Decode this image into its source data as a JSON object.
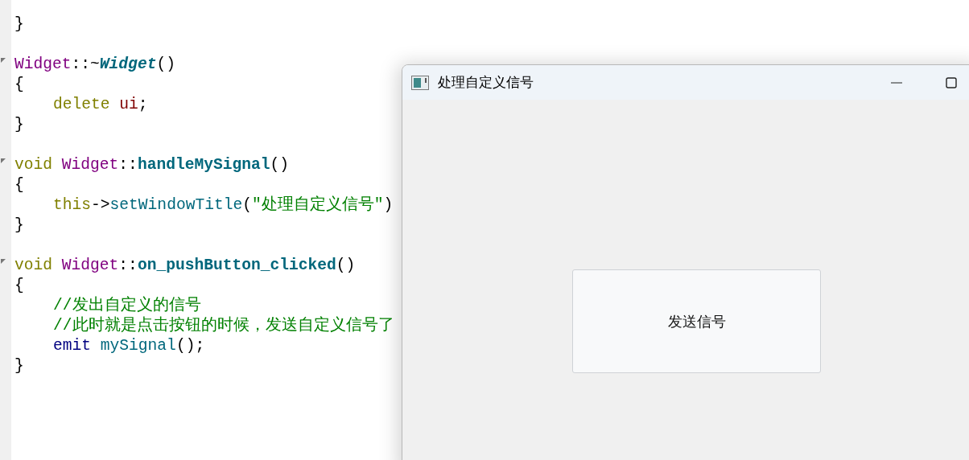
{
  "editor": {
    "blocks": [
      [
        {
          "fold": false,
          "indent": false,
          "tokens": [
            {
              "text": "}",
              "kind": "plain"
            }
          ]
        }
      ],
      [
        {
          "fold": true,
          "indent": false,
          "tokens": [
            {
              "text": "Widget",
              "kind": "type"
            },
            {
              "text": "::~",
              "kind": "plain"
            },
            {
              "text": "Widget",
              "kind": "dtor"
            },
            {
              "text": "()",
              "kind": "plain"
            }
          ]
        },
        {
          "fold": false,
          "indent": false,
          "tokens": [
            {
              "text": "{",
              "kind": "plain"
            }
          ]
        },
        {
          "fold": false,
          "indent": true,
          "tokens": [
            {
              "text": "delete ",
              "kind": "keyword"
            },
            {
              "text": "ui",
              "kind": "member"
            },
            {
              "text": ";",
              "kind": "plain"
            }
          ]
        },
        {
          "fold": false,
          "indent": false,
          "tokens": [
            {
              "text": "}",
              "kind": "plain"
            }
          ]
        }
      ],
      [
        {
          "fold": true,
          "indent": false,
          "tokens": [
            {
              "text": "void ",
              "kind": "keyword"
            },
            {
              "text": "Widget",
              "kind": "type"
            },
            {
              "text": "::",
              "kind": "plain"
            },
            {
              "text": "handleMySignal",
              "kind": "def"
            },
            {
              "text": "()",
              "kind": "plain"
            }
          ]
        },
        {
          "fold": false,
          "indent": false,
          "tokens": [
            {
              "text": "{",
              "kind": "plain"
            }
          ]
        },
        {
          "fold": false,
          "indent": true,
          "tokens": [
            {
              "text": "this",
              "kind": "keyword"
            },
            {
              "text": "->",
              "kind": "plain"
            },
            {
              "text": "setWindowTitle",
              "kind": "func"
            },
            {
              "text": "(",
              "kind": "plain"
            },
            {
              "text": "\"处理自定义信号\"",
              "kind": "string"
            },
            {
              "text": ")",
              "kind": "plain"
            }
          ]
        },
        {
          "fold": false,
          "indent": false,
          "tokens": [
            {
              "text": "}",
              "kind": "plain"
            }
          ]
        }
      ],
      [
        {
          "fold": true,
          "indent": false,
          "tokens": [
            {
              "text": "void ",
              "kind": "keyword"
            },
            {
              "text": "Widget",
              "kind": "type"
            },
            {
              "text": "::",
              "kind": "plain"
            },
            {
              "text": "on_pushButton_clicked",
              "kind": "def"
            },
            {
              "text": "()",
              "kind": "plain"
            }
          ]
        },
        {
          "fold": false,
          "indent": false,
          "tokens": [
            {
              "text": "{",
              "kind": "plain"
            }
          ]
        },
        {
          "fold": false,
          "indent": true,
          "tokens": [
            {
              "text": "//发出自定义的信号",
              "kind": "comment"
            }
          ]
        },
        {
          "fold": false,
          "indent": true,
          "tokens": [
            {
              "text": "//此时就是点击按钮的时候，发送自定义信号了",
              "kind": "comment"
            }
          ]
        },
        {
          "fold": false,
          "indent": true,
          "tokens": [
            {
              "text": "emit ",
              "kind": "macro"
            },
            {
              "text": "mySignal",
              "kind": "func"
            },
            {
              "text": "();",
              "kind": "plain"
            }
          ]
        },
        {
          "fold": false,
          "indent": false,
          "tokens": [
            {
              "text": "}",
              "kind": "plain"
            }
          ]
        }
      ]
    ]
  },
  "window": {
    "title": "处理自定义信号",
    "button": "发送信号"
  }
}
